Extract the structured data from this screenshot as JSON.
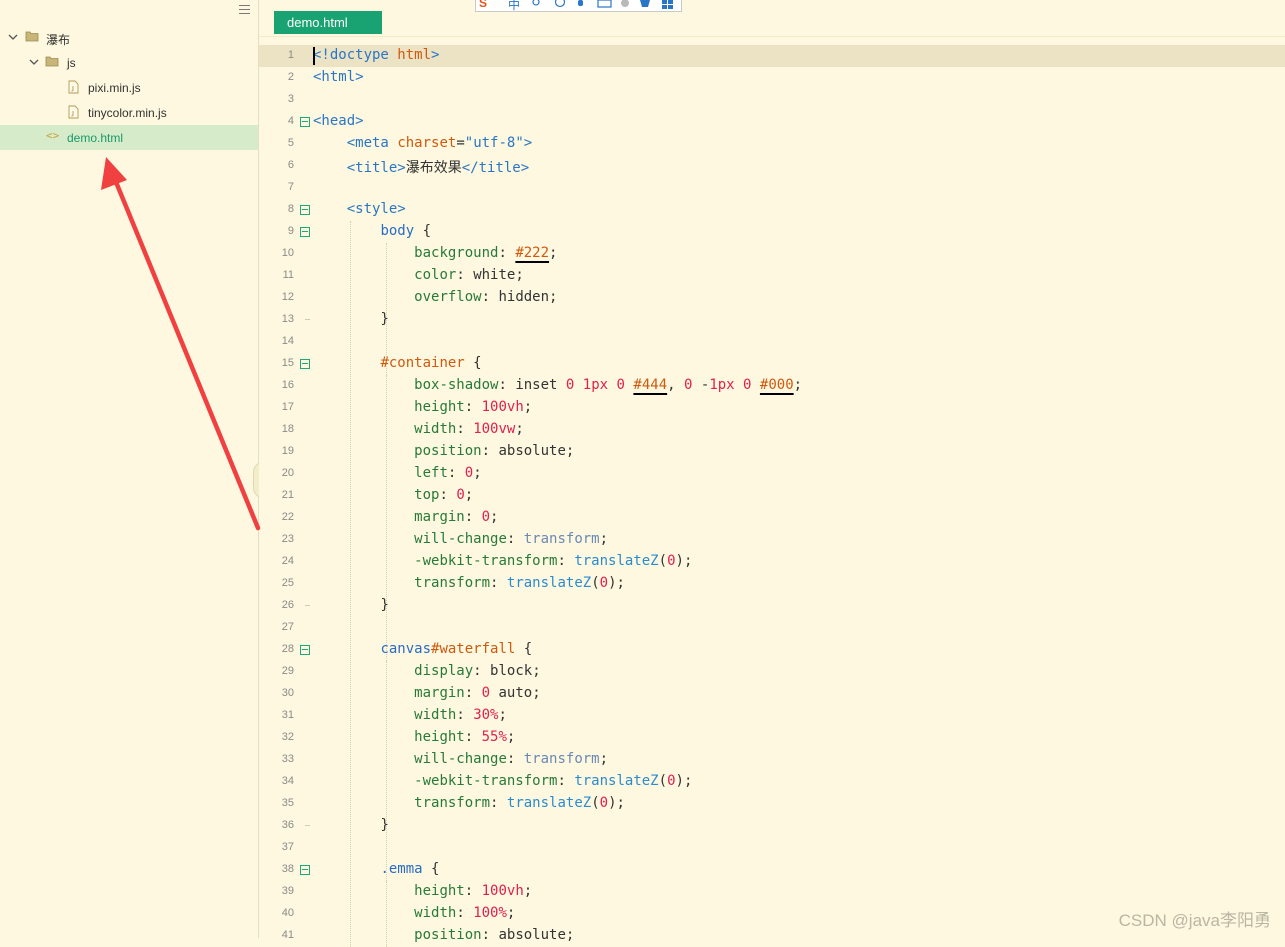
{
  "sidebar": {
    "tree": [
      {
        "label": "瀑布",
        "icon": "folder-icon",
        "expand": "chevron-down-icon"
      },
      {
        "label": "js",
        "icon": "folder-icon",
        "expand": "chevron-down-icon"
      },
      {
        "label": "pixi.min.js",
        "icon": "js-file-icon"
      },
      {
        "label": "tinycolor.min.js",
        "icon": "js-file-icon"
      },
      {
        "label": "demo.html",
        "icon": "html-file-icon",
        "selected": true
      }
    ]
  },
  "editor": {
    "tabs": [
      {
        "label": "demo.html",
        "active": true
      }
    ],
    "current_line": 1,
    "line_numbers": [
      "1",
      "2",
      "3",
      "4",
      "5",
      "6",
      "7",
      "8",
      "9",
      "10",
      "11",
      "12",
      "13",
      "14",
      "15",
      "16",
      "17",
      "18",
      "19",
      "20",
      "21",
      "22",
      "23",
      "24",
      "25",
      "26",
      "27",
      "28",
      "29",
      "30",
      "31",
      "32",
      "33",
      "34",
      "35",
      "36",
      "37",
      "38",
      "39",
      "40",
      "41"
    ],
    "lines": [
      "<!doctype html>",
      "<html>",
      "",
      "<head>",
      "    <meta charset=\"utf-8\">",
      "    <title>瀑布效果</title>",
      "",
      "    <style>",
      "        body {",
      "            background: #222;",
      "            color: white;",
      "            overflow: hidden;",
      "        }",
      "",
      "        #container {",
      "            box-shadow: inset 0 1px 0 #444, 0 -1px 0 #000;",
      "            height: 100vh;",
      "            width: 100vw;",
      "            position: absolute;",
      "            left: 0;",
      "            top: 0;",
      "            margin: 0;",
      "            will-change: transform;",
      "            -webkit-transform: translateZ(0);",
      "            transform: translateZ(0);",
      "        }",
      "",
      "        canvas#waterfall {",
      "            display: block;",
      "            margin: 0 auto;",
      "            width: 30%;",
      "            height: 55%;",
      "            will-change: transform;",
      "            -webkit-transform: translateZ(0);",
      "            transform: translateZ(0);",
      "        }",
      "",
      "        .emma {",
      "            height: 100vh;",
      "            width: 100%;",
      "            position: absolute;"
    ]
  },
  "ime_toolbar": {
    "items": [
      "S",
      "中"
    ]
  },
  "watermark": "CSDN @java李阳勇",
  "colors": {
    "accent": "#19a272",
    "background": "#fdf8df",
    "annotation_arrow": "#f04040"
  }
}
